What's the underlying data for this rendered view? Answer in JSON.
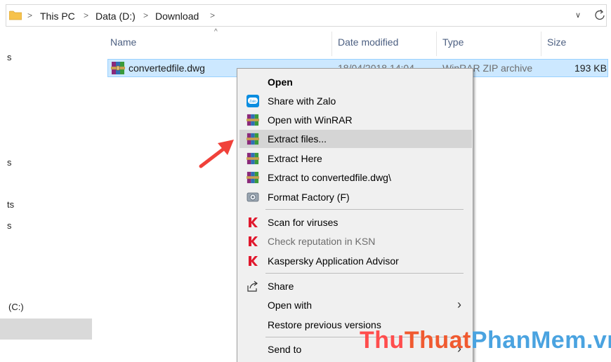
{
  "address": {
    "crumbs": [
      "This PC",
      "Data (D:)",
      "Download"
    ],
    "separator": ">",
    "dropdown": "∨",
    "refresh": "↻"
  },
  "nav": {
    "fragments": [
      "s",
      "s",
      "ts",
      "s",
      "(C:)"
    ]
  },
  "columns": {
    "name": "Name",
    "date": "Date modified",
    "type": "Type",
    "size": "Size"
  },
  "file": {
    "name": "convertedfile.dwg",
    "date": "18/04/2018 14:04",
    "type": "WinRAR ZIP archive",
    "size": "193 KB"
  },
  "menu": {
    "items": [
      {
        "label": "Open",
        "icon": "none",
        "bold": true
      },
      {
        "label": "Share with Zalo",
        "icon": "zalo-icon"
      },
      {
        "label": "Open with WinRAR",
        "icon": "winrar-icon"
      },
      {
        "label": "Extract files...",
        "icon": "winrar-icon",
        "highlighted": true
      },
      {
        "label": "Extract Here",
        "icon": "winrar-icon"
      },
      {
        "label": "Extract to convertedfile.dwg\\",
        "icon": "winrar-icon"
      },
      {
        "label": "Format Factory (F)",
        "icon": "format-factory-icon"
      },
      {
        "label": "Scan for viruses",
        "icon": "kaspersky-icon"
      },
      {
        "label": "Check reputation in KSN",
        "icon": "kaspersky-icon",
        "disabled": true
      },
      {
        "label": "Kaspersky Application Advisor",
        "icon": "kaspersky-icon"
      },
      {
        "label": "Share",
        "icon": "share-icon"
      },
      {
        "label": "Open with",
        "icon": "none",
        "submenu": true
      },
      {
        "label": "Restore previous versions",
        "icon": "none"
      },
      {
        "label": "Send to",
        "icon": "none",
        "submenu": true
      }
    ],
    "submenu_glyph": "›"
  },
  "watermark": {
    "part1": "Thu",
    "part2": "Thuat",
    "part3": "PhanMem",
    "part4": ".vn"
  },
  "colors": {
    "selection": "#cce8ff",
    "menu_bg": "#f0f0f0",
    "menu_highlight": "#d5d5d5",
    "arrow": "#f0413a"
  }
}
